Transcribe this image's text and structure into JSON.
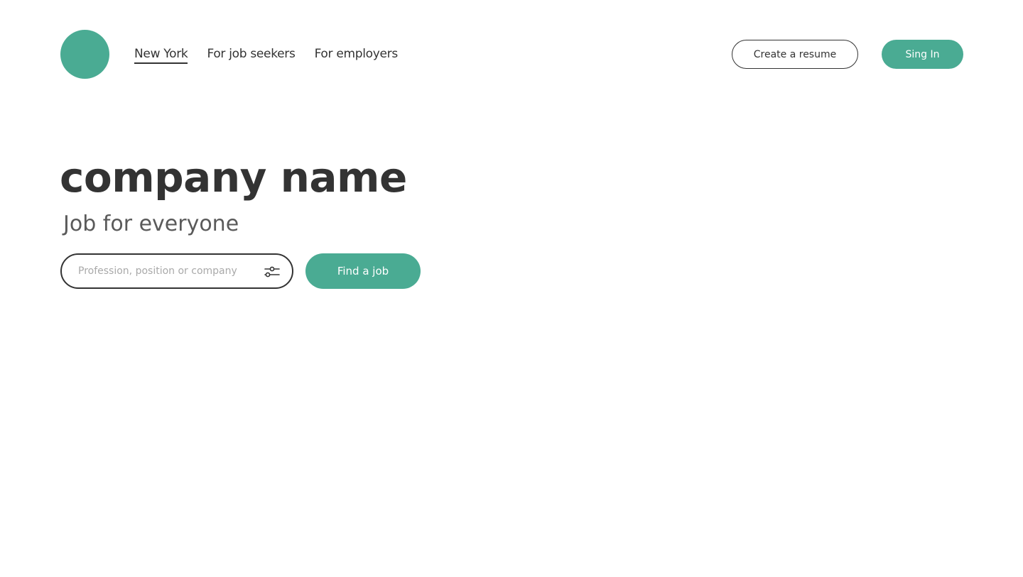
{
  "header": {
    "nav": [
      {
        "label": "New York"
      },
      {
        "label": "For job seekers"
      },
      {
        "label": "For employers"
      }
    ],
    "create_resume_label": "Create a resume",
    "sign_in_label": "Sing In"
  },
  "hero": {
    "title": "company name",
    "subtitle": "Job for everyone"
  },
  "search": {
    "placeholder": "Profession, position or company",
    "value": "",
    "filter_icon": "sliders-icon",
    "button_label": "Find a job"
  },
  "colors": {
    "accent": "#4aab93",
    "text": "#333333",
    "subtitle": "#5a5a5a",
    "placeholder": "#a9a9a9"
  }
}
